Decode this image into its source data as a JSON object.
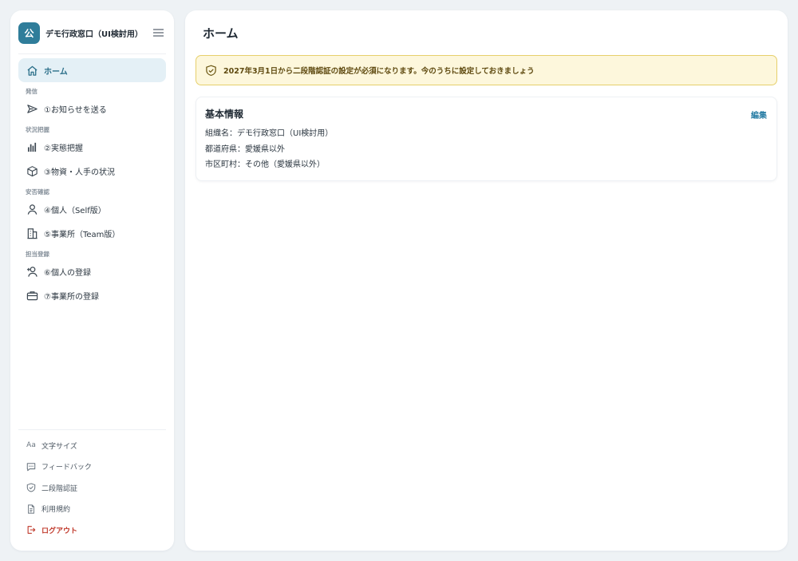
{
  "sidebar": {
    "logo_text": "公",
    "org_name": "デモ行政窓口（UI検討用）",
    "nav": {
      "home": {
        "label": "ホーム",
        "icon": "home-icon"
      },
      "sections": [
        {
          "label": "発信",
          "items": [
            {
              "label": "①お知らせを送る",
              "icon": "send-icon"
            }
          ]
        },
        {
          "label": "状況把握",
          "items": [
            {
              "label": "②実態把握",
              "icon": "bar-chart-icon"
            },
            {
              "label": "③物資・人手の状況",
              "icon": "box-icon"
            }
          ]
        },
        {
          "label": "安否確認",
          "items": [
            {
              "label": "④個人（Self版）",
              "icon": "user-icon"
            },
            {
              "label": "⑤事業所（Team版）",
              "icon": "building-icon"
            }
          ]
        },
        {
          "label": "担当登録",
          "items": [
            {
              "label": "⑥個人の登録",
              "icon": "user-plus-icon"
            },
            {
              "label": "⑦事業所の登録",
              "icon": "briefcase-icon"
            }
          ]
        }
      ]
    },
    "footer": [
      {
        "label": "文字サイズ",
        "icon": "font-size-icon",
        "glyph": "Aa"
      },
      {
        "label": "フィードバック",
        "icon": "feedback-icon"
      },
      {
        "label": "二段階認証",
        "icon": "shield-icon"
      },
      {
        "label": "利用規約",
        "icon": "document-icon"
      },
      {
        "label": "ログアウト",
        "icon": "logout-icon"
      }
    ]
  },
  "main": {
    "title": "ホーム",
    "alert": "2027年3月1日から二段階認証の設定が必須になります。今のうちに設定しておきましょう",
    "card": {
      "title": "基本情報",
      "edit_label": "編集",
      "rows": [
        "組織名：デモ行政窓口（UI検討用）",
        "都道府県：愛媛県以外",
        "市区町村：その他（愛媛県以外）"
      ]
    }
  },
  "colors": {
    "accent": "#2f7d9a",
    "active_bg": "#e4f0f6",
    "alert_bg": "#fdf7dc",
    "alert_border": "#e6cf6b",
    "logout": "#c0392b",
    "background": "#eef2f5"
  }
}
